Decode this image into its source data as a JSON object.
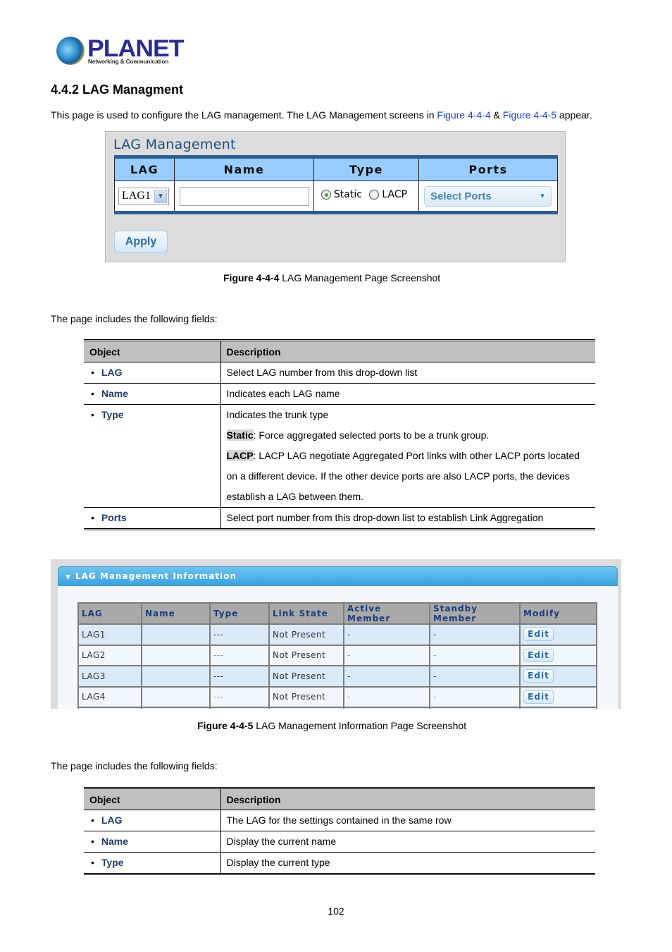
{
  "logo": {
    "brand": "PLANET",
    "tagline": "Networking & Communication"
  },
  "section_title": "4.4.2 LAG Managment",
  "intro": {
    "before": "This page is used to configure the LAG management. The LAG Management screens in ",
    "link1": "Figure 4-4-4",
    "middle": " & ",
    "link2": "Figure 4-4-5",
    "after": " appear."
  },
  "figure1": {
    "title": "LAG Management",
    "headers": [
      "LAG",
      "Name",
      "Type",
      "Ports"
    ],
    "lag_select_value": "LAG1",
    "name_value": "",
    "type_options": [
      {
        "label": "Static",
        "selected": true
      },
      {
        "label": "LACP",
        "selected": false
      }
    ],
    "ports_placeholder": "Select Ports",
    "apply_label": "Apply",
    "caption_bold": "Figure 4-4-4",
    "caption_text": " LAG Management Page Screenshot"
  },
  "fields_intro_1": "The page includes the following fields:",
  "table1": {
    "headers": [
      "Object",
      "Description"
    ],
    "rows": [
      {
        "object": "LAG",
        "lines": [
          "Select LAG number from this drop-down list"
        ]
      },
      {
        "object": "Name",
        "lines": [
          "Indicates each LAG name"
        ]
      },
      {
        "object": "Type",
        "lines": [
          "Indicates the trunk type"
        ],
        "static_term": "Static",
        "static_text": ": Force aggregated selected ports to be a trunk group.",
        "lacp_term": "LACP",
        "lacp_text": ": LACP LAG negotiate Aggregated Port links with other LACP ports located",
        "extra_lines": [
          "on a different device. If the other device ports are also LACP ports, the devices",
          "establish a LAG between them."
        ]
      },
      {
        "object": "Ports",
        "lines": [
          "Select port number from this drop-down list to establish Link Aggregation"
        ]
      }
    ]
  },
  "figure2": {
    "panel_title": "LAG Management Information",
    "headers": [
      "LAG",
      "Name",
      "Type",
      "Link State",
      "Active Member",
      "Standby Member",
      "Modify"
    ],
    "rows": [
      {
        "lag": "LAG1",
        "name": "",
        "type": "---",
        "link_state": "Not Present",
        "active": "-",
        "standby": "-",
        "modify": "Edit"
      },
      {
        "lag": "LAG2",
        "name": "",
        "type": "---",
        "link_state": "Not Present",
        "active": "-",
        "standby": "-",
        "modify": "Edit"
      },
      {
        "lag": "LAG3",
        "name": "",
        "type": "---",
        "link_state": "Not Present",
        "active": "-",
        "standby": "-",
        "modify": "Edit"
      },
      {
        "lag": "LAG4",
        "name": "",
        "type": "---",
        "link_state": "Not Present",
        "active": "-",
        "standby": "-",
        "modify": "Edit"
      }
    ],
    "caption_bold": "Figure 4-4-5",
    "caption_text": " LAG Management Information Page Screenshot"
  },
  "fields_intro_2": "The page includes the following fields:",
  "table2": {
    "headers": [
      "Object",
      "Description"
    ],
    "rows": [
      {
        "object": "LAG",
        "description": "The LAG for the settings contained in the same row"
      },
      {
        "object": "Name",
        "description": "Display the current name"
      },
      {
        "object": "Type",
        "description": "Display the current type"
      }
    ]
  },
  "page_number": "102"
}
